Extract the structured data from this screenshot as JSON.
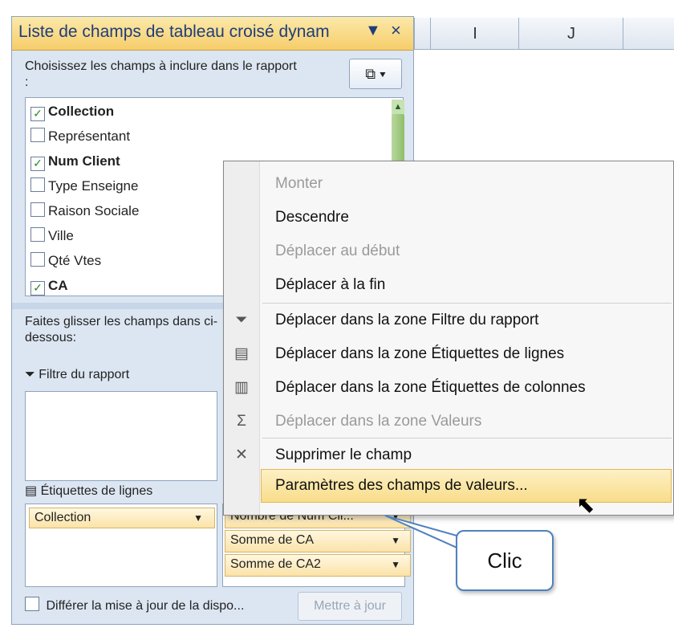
{
  "sheet": {
    "columns": [
      "I",
      "J"
    ]
  },
  "panel": {
    "title": "Liste de champs de tableau croisé dynam",
    "title_dropdown": "▼",
    "close": "×",
    "choose_label": "Choisissez les champs à inclure dans le rapport :",
    "layout_button": "⧉ ▾",
    "fields": [
      {
        "label": "Collection",
        "checked": true
      },
      {
        "label": "Représentant",
        "checked": false
      },
      {
        "label": "Num Client",
        "checked": true
      },
      {
        "label": "Type Enseigne",
        "checked": false
      },
      {
        "label": "Raison Sociale",
        "checked": false
      },
      {
        "label": "Ville",
        "checked": false
      },
      {
        "label": "Qté Vtes",
        "checked": false
      },
      {
        "label": "CA",
        "checked": true
      }
    ],
    "drag_label": "Faites glisser les champs dans ci-dessous:",
    "filter_area": "Filtre du rapport",
    "rows_area": "Étiquettes de lignes",
    "row_chips": [
      "Collection"
    ],
    "value_chips": [
      "Nombre de Num Cli...",
      "Somme de CA",
      "Somme de CA2"
    ],
    "defer_label": "Différer la mise à jour de la dispo...",
    "update_button": "Mettre à jour"
  },
  "menu": {
    "items": [
      {
        "label": "Monter",
        "disabled": true
      },
      {
        "label": "Descendre",
        "disabled": false
      },
      {
        "label": "Déplacer au début",
        "disabled": true
      },
      {
        "label": "Déplacer à la fin",
        "disabled": false
      },
      {
        "label": "Déplacer dans la zone Filtre du rapport",
        "disabled": false,
        "icon": "filter-icon"
      },
      {
        "label": "Déplacer dans la zone Étiquettes de lignes",
        "disabled": false,
        "icon": "row-labels-icon"
      },
      {
        "label": "Déplacer dans la zone Étiquettes de colonnes",
        "disabled": false,
        "icon": "column-labels-icon"
      },
      {
        "label": "Déplacer dans la zone Valeurs",
        "disabled": true,
        "icon": "sigma-icon"
      },
      {
        "label": "Supprimer le champ",
        "disabled": false,
        "icon": "remove-icon"
      },
      {
        "label": "Paramètres des champs de valeurs...",
        "disabled": false,
        "highlighted": true
      }
    ]
  },
  "callout": {
    "text": "Clic"
  },
  "colors": {
    "title_bar": "#f6cd6a",
    "panel_bg": "#dce6f2",
    "highlight": "#f8dd8a",
    "callout_border": "#4f81bd"
  }
}
